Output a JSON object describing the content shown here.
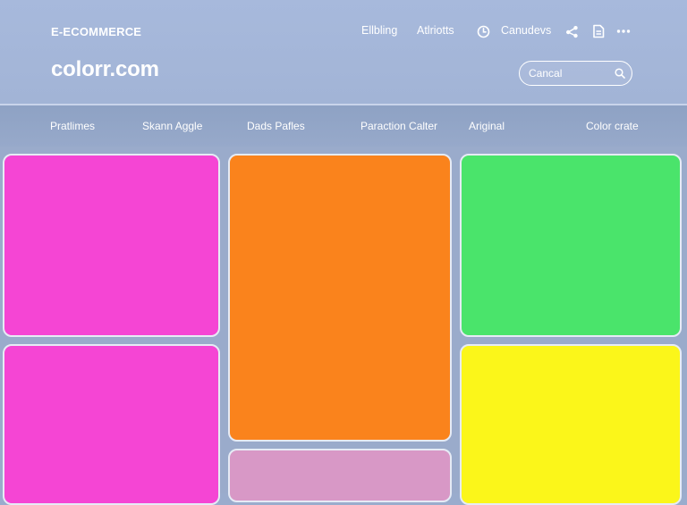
{
  "header": {
    "brand_small": "E-ECOMMERCE",
    "site_name": "colorr.com",
    "links": [
      "Ellbling",
      "Atlriotts",
      "Canudevs"
    ],
    "icons": [
      "clock-icon",
      "share-icon",
      "document-icon",
      "more-icon"
    ],
    "search": {
      "value": "",
      "placeholder": "Cancal"
    }
  },
  "nav": {
    "items": [
      "Pratlimes",
      "Skann Aggle",
      "Dads Pafles",
      "Paraction Calter",
      "Ariginal",
      "Color crate"
    ]
  },
  "tiles": [
    {
      "name": "tile-magenta-top",
      "color": "#f545d4"
    },
    {
      "name": "tile-orange",
      "color": "#fa831c"
    },
    {
      "name": "tile-green",
      "color": "#4ae46b"
    },
    {
      "name": "tile-magenta-bottom",
      "color": "#f545d4"
    },
    {
      "name": "tile-pink",
      "color": "#d898c6"
    },
    {
      "name": "tile-yellow",
      "color": "#fbf61a"
    }
  ]
}
